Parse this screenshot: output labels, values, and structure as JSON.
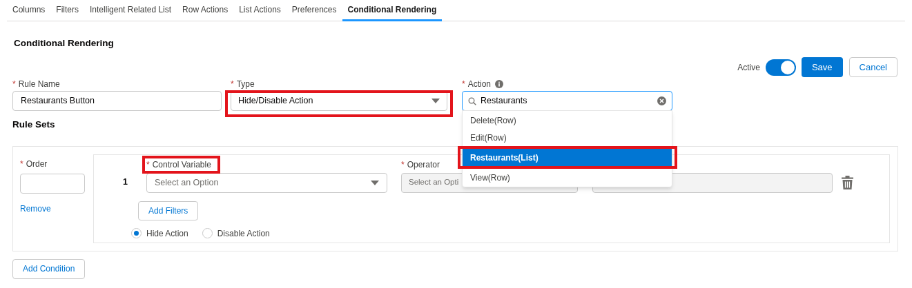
{
  "tabs": [
    {
      "label": "Columns",
      "selected": false
    },
    {
      "label": "Filters",
      "selected": false
    },
    {
      "label": "Intelligent Related List",
      "selected": false
    },
    {
      "label": "Row Actions",
      "selected": false
    },
    {
      "label": "List Actions",
      "selected": false
    },
    {
      "label": "Preferences",
      "selected": false
    },
    {
      "label": "Conditional Rendering",
      "selected": true
    }
  ],
  "section_title": "Conditional Rendering",
  "header_actions": {
    "active_label": "Active",
    "active_on": true,
    "save": "Save",
    "cancel": "Cancel"
  },
  "rule_name": {
    "required": "*",
    "label": "Rule Name",
    "value": "Restaurants Button"
  },
  "type": {
    "required": "*",
    "label": "Type",
    "value": "Hide/Disable Action",
    "highlighted": true
  },
  "action": {
    "required": "*",
    "label": "Action",
    "value": "Restaurants",
    "options": [
      {
        "label": "Delete(Row)",
        "selected": false,
        "highlighted": false
      },
      {
        "label": "Edit(Row)",
        "selected": false,
        "highlighted": false
      },
      {
        "label": "Restaurants(List)",
        "selected": true,
        "highlighted": true
      },
      {
        "label": "View(Row)",
        "selected": false,
        "highlighted": false
      }
    ]
  },
  "rule_sets_title": "Rule Sets",
  "rule_set": {
    "order": {
      "required": "*",
      "label": "Order"
    },
    "remove": "Remove",
    "index": "1",
    "control_variable": {
      "required": "*",
      "label": "Control Variable",
      "placeholder": "Select an Option",
      "highlighted": true
    },
    "operator": {
      "required": "*",
      "label": "Operator",
      "placeholder": "Select an Opti",
      "disabled": true
    },
    "value_disabled": true,
    "add_filters": "Add Filters",
    "radios": [
      {
        "label": "Hide Action",
        "selected": true
      },
      {
        "label": "Disable Action",
        "selected": false
      }
    ]
  },
  "add_condition": "Add Condition"
}
